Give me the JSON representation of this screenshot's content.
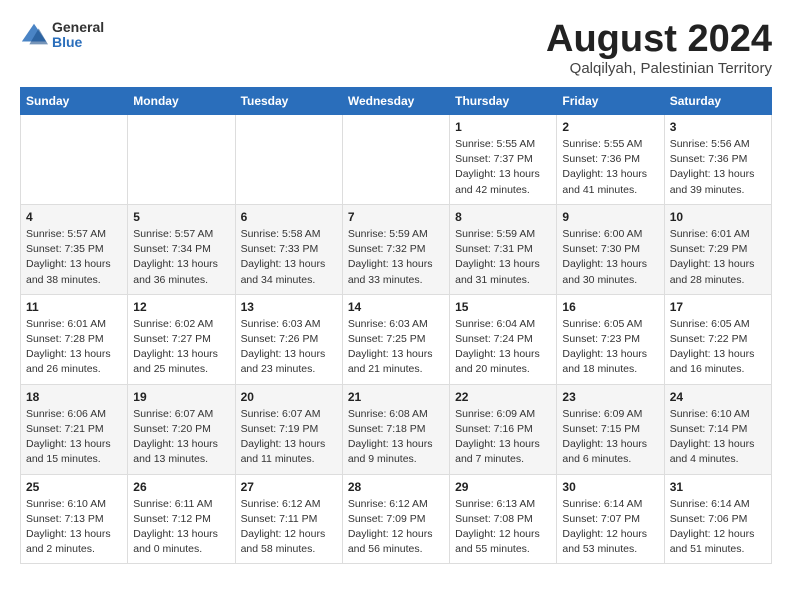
{
  "logo": {
    "general": "General",
    "blue": "Blue"
  },
  "title": "August 2024",
  "location": "Qalqilyah, Palestinian Territory",
  "weekdays": [
    "Sunday",
    "Monday",
    "Tuesday",
    "Wednesday",
    "Thursday",
    "Friday",
    "Saturday"
  ],
  "weeks": [
    [
      {
        "day": "",
        "info": ""
      },
      {
        "day": "",
        "info": ""
      },
      {
        "day": "",
        "info": ""
      },
      {
        "day": "",
        "info": ""
      },
      {
        "day": "1",
        "info": "Sunrise: 5:55 AM\nSunset: 7:37 PM\nDaylight: 13 hours\nand 42 minutes."
      },
      {
        "day": "2",
        "info": "Sunrise: 5:55 AM\nSunset: 7:36 PM\nDaylight: 13 hours\nand 41 minutes."
      },
      {
        "day": "3",
        "info": "Sunrise: 5:56 AM\nSunset: 7:36 PM\nDaylight: 13 hours\nand 39 minutes."
      }
    ],
    [
      {
        "day": "4",
        "info": "Sunrise: 5:57 AM\nSunset: 7:35 PM\nDaylight: 13 hours\nand 38 minutes."
      },
      {
        "day": "5",
        "info": "Sunrise: 5:57 AM\nSunset: 7:34 PM\nDaylight: 13 hours\nand 36 minutes."
      },
      {
        "day": "6",
        "info": "Sunrise: 5:58 AM\nSunset: 7:33 PM\nDaylight: 13 hours\nand 34 minutes."
      },
      {
        "day": "7",
        "info": "Sunrise: 5:59 AM\nSunset: 7:32 PM\nDaylight: 13 hours\nand 33 minutes."
      },
      {
        "day": "8",
        "info": "Sunrise: 5:59 AM\nSunset: 7:31 PM\nDaylight: 13 hours\nand 31 minutes."
      },
      {
        "day": "9",
        "info": "Sunrise: 6:00 AM\nSunset: 7:30 PM\nDaylight: 13 hours\nand 30 minutes."
      },
      {
        "day": "10",
        "info": "Sunrise: 6:01 AM\nSunset: 7:29 PM\nDaylight: 13 hours\nand 28 minutes."
      }
    ],
    [
      {
        "day": "11",
        "info": "Sunrise: 6:01 AM\nSunset: 7:28 PM\nDaylight: 13 hours\nand 26 minutes."
      },
      {
        "day": "12",
        "info": "Sunrise: 6:02 AM\nSunset: 7:27 PM\nDaylight: 13 hours\nand 25 minutes."
      },
      {
        "day": "13",
        "info": "Sunrise: 6:03 AM\nSunset: 7:26 PM\nDaylight: 13 hours\nand 23 minutes."
      },
      {
        "day": "14",
        "info": "Sunrise: 6:03 AM\nSunset: 7:25 PM\nDaylight: 13 hours\nand 21 minutes."
      },
      {
        "day": "15",
        "info": "Sunrise: 6:04 AM\nSunset: 7:24 PM\nDaylight: 13 hours\nand 20 minutes."
      },
      {
        "day": "16",
        "info": "Sunrise: 6:05 AM\nSunset: 7:23 PM\nDaylight: 13 hours\nand 18 minutes."
      },
      {
        "day": "17",
        "info": "Sunrise: 6:05 AM\nSunset: 7:22 PM\nDaylight: 13 hours\nand 16 minutes."
      }
    ],
    [
      {
        "day": "18",
        "info": "Sunrise: 6:06 AM\nSunset: 7:21 PM\nDaylight: 13 hours\nand 15 minutes."
      },
      {
        "day": "19",
        "info": "Sunrise: 6:07 AM\nSunset: 7:20 PM\nDaylight: 13 hours\nand 13 minutes."
      },
      {
        "day": "20",
        "info": "Sunrise: 6:07 AM\nSunset: 7:19 PM\nDaylight: 13 hours\nand 11 minutes."
      },
      {
        "day": "21",
        "info": "Sunrise: 6:08 AM\nSunset: 7:18 PM\nDaylight: 13 hours\nand 9 minutes."
      },
      {
        "day": "22",
        "info": "Sunrise: 6:09 AM\nSunset: 7:16 PM\nDaylight: 13 hours\nand 7 minutes."
      },
      {
        "day": "23",
        "info": "Sunrise: 6:09 AM\nSunset: 7:15 PM\nDaylight: 13 hours\nand 6 minutes."
      },
      {
        "day": "24",
        "info": "Sunrise: 6:10 AM\nSunset: 7:14 PM\nDaylight: 13 hours\nand 4 minutes."
      }
    ],
    [
      {
        "day": "25",
        "info": "Sunrise: 6:10 AM\nSunset: 7:13 PM\nDaylight: 13 hours\nand 2 minutes."
      },
      {
        "day": "26",
        "info": "Sunrise: 6:11 AM\nSunset: 7:12 PM\nDaylight: 13 hours\nand 0 minutes."
      },
      {
        "day": "27",
        "info": "Sunrise: 6:12 AM\nSunset: 7:11 PM\nDaylight: 12 hours\nand 58 minutes."
      },
      {
        "day": "28",
        "info": "Sunrise: 6:12 AM\nSunset: 7:09 PM\nDaylight: 12 hours\nand 56 minutes."
      },
      {
        "day": "29",
        "info": "Sunrise: 6:13 AM\nSunset: 7:08 PM\nDaylight: 12 hours\nand 55 minutes."
      },
      {
        "day": "30",
        "info": "Sunrise: 6:14 AM\nSunset: 7:07 PM\nDaylight: 12 hours\nand 53 minutes."
      },
      {
        "day": "31",
        "info": "Sunrise: 6:14 AM\nSunset: 7:06 PM\nDaylight: 12 hours\nand 51 minutes."
      }
    ]
  ]
}
